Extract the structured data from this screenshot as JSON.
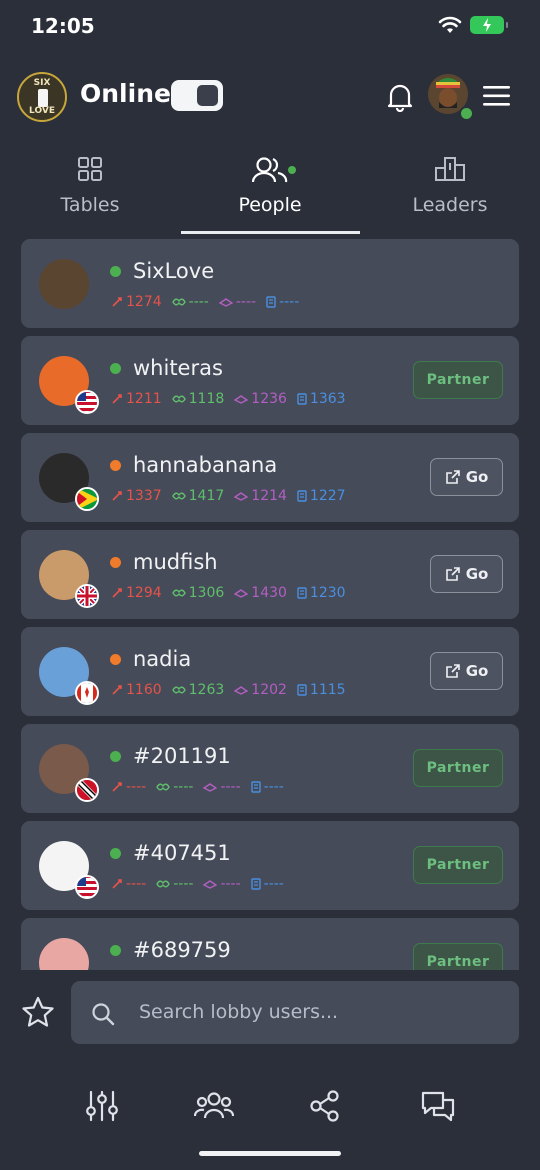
{
  "status": {
    "time": "12:05"
  },
  "header": {
    "logo_top": "SIX",
    "logo_bottom": "LOVE",
    "online_label": "Online"
  },
  "tabs": [
    {
      "label": "Tables",
      "icon": "grid-icon"
    },
    {
      "label": "People",
      "icon": "people-icon",
      "active": true
    },
    {
      "label": "Leaders",
      "icon": "podium-icon"
    }
  ],
  "people": [
    {
      "name": "SixLove",
      "status": "online",
      "status_color": "#4cb050",
      "flag": "",
      "stats": [
        "1274",
        "----",
        "----",
        "----"
      ],
      "action": ""
    },
    {
      "name": "whiteras",
      "status": "online",
      "status_color": "#4cb050",
      "flag": "us",
      "stats": [
        "1211",
        "1118",
        "1236",
        "1363"
      ],
      "action": "Partner"
    },
    {
      "name": "hannabanana",
      "status": "away",
      "status_color": "#f07b2a",
      "flag": "gy",
      "stats": [
        "1337",
        "1417",
        "1214",
        "1227"
      ],
      "action": "Go"
    },
    {
      "name": "mudfish",
      "status": "away",
      "status_color": "#f07b2a",
      "flag": "gb",
      "stats": [
        "1294",
        "1306",
        "1430",
        "1230"
      ],
      "action": "Go"
    },
    {
      "name": "nadia",
      "status": "away",
      "status_color": "#f07b2a",
      "flag": "ca",
      "stats": [
        "1160",
        "1263",
        "1202",
        "1115"
      ],
      "action": "Go"
    },
    {
      "name": "#201191",
      "status": "online",
      "status_color": "#4cb050",
      "flag": "tt",
      "stats": [
        "----",
        "----",
        "----",
        "----"
      ],
      "action": "Partner"
    },
    {
      "name": "#407451",
      "status": "online",
      "status_color": "#4cb050",
      "flag": "us",
      "stats": [
        "----",
        "----",
        "----",
        "----"
      ],
      "action": "Partner"
    },
    {
      "name": "#689759",
      "status": "online",
      "status_color": "#4cb050",
      "flag": "",
      "stats": [
        "",
        "",
        "",
        ""
      ],
      "action": "Partner"
    }
  ],
  "search": {
    "placeholder": "Search lobby users..."
  },
  "bottom_nav": [
    "sliders-icon",
    "people-icon",
    "share-icon",
    "chat-icon"
  ]
}
